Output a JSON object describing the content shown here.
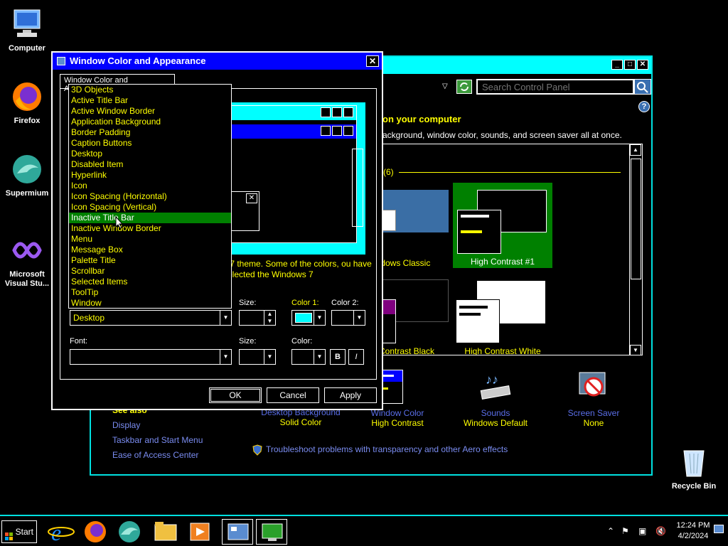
{
  "desktop": {
    "icons": [
      {
        "label": "Computer"
      },
      {
        "label": "Firefox"
      },
      {
        "label": "Supermium"
      },
      {
        "label": "Microsoft Visual Stu..."
      },
      {
        "label": "Recycle Bin"
      }
    ]
  },
  "control_panel": {
    "search_placeholder": "Search Control Panel",
    "heading": "on your computer",
    "subheading": "ackground, window color, sounds, and screen saver all at once.",
    "group_label": "(6)",
    "themes": [
      {
        "label": "ndows Classic"
      },
      {
        "label": "High Contrast #1"
      },
      {
        "label": "h Contrast Black"
      },
      {
        "label": "High Contrast White"
      }
    ],
    "bottom_items": [
      {
        "title": "Desktop Background",
        "value": "Solid Color"
      },
      {
        "title": "Window Color",
        "value": "High Contrast"
      },
      {
        "title": "Sounds",
        "value": "Windows Default"
      },
      {
        "title": "Screen Saver",
        "value": "None"
      }
    ],
    "see_also": "See also",
    "see_also_links": [
      "Display",
      "Taskbar and Start Menu",
      "Ease of Access Center"
    ],
    "troubleshoot": "Troubleshoot problems with transparency and other Aero effects"
  },
  "dialog": {
    "title": "Window Color and Appearance",
    "tab": "Window Color and Appearance",
    "description": "s 7 theme.  Some of the colors, ou have selected the Windows 7",
    "item_value": "Desktop",
    "labels": {
      "size": "Size:",
      "color1": "Color 1:",
      "color2": "Color 2:",
      "font": "Font:",
      "font_size": "Size:",
      "font_color": "Color:"
    },
    "bold": "B",
    "italic": "I",
    "ok": "OK",
    "cancel": "Cancel",
    "apply": "Apply",
    "items": [
      "3D Objects",
      "Active Title Bar",
      "Active Window Border",
      "Application Background",
      "Border Padding",
      "Caption Buttons",
      "Desktop",
      "Disabled Item",
      "Hyperlink",
      "Icon",
      "Icon Spacing (Horizontal)",
      "Icon Spacing (Vertical)",
      "Inactive Title Bar",
      "Inactive Window Border",
      "Menu",
      "Message Box",
      "Palette Title",
      "Scrollbar",
      "Selected Items",
      "ToolTip",
      "Window"
    ],
    "selected_item": "Inactive Title Bar"
  },
  "taskbar": {
    "start": "Start",
    "time": "12:24 PM",
    "date": "4/2/2024"
  },
  "colors": {
    "accent": "#00ffff",
    "highlight": "#008000",
    "title_active": "#0000ff",
    "text": "#ffff00"
  }
}
